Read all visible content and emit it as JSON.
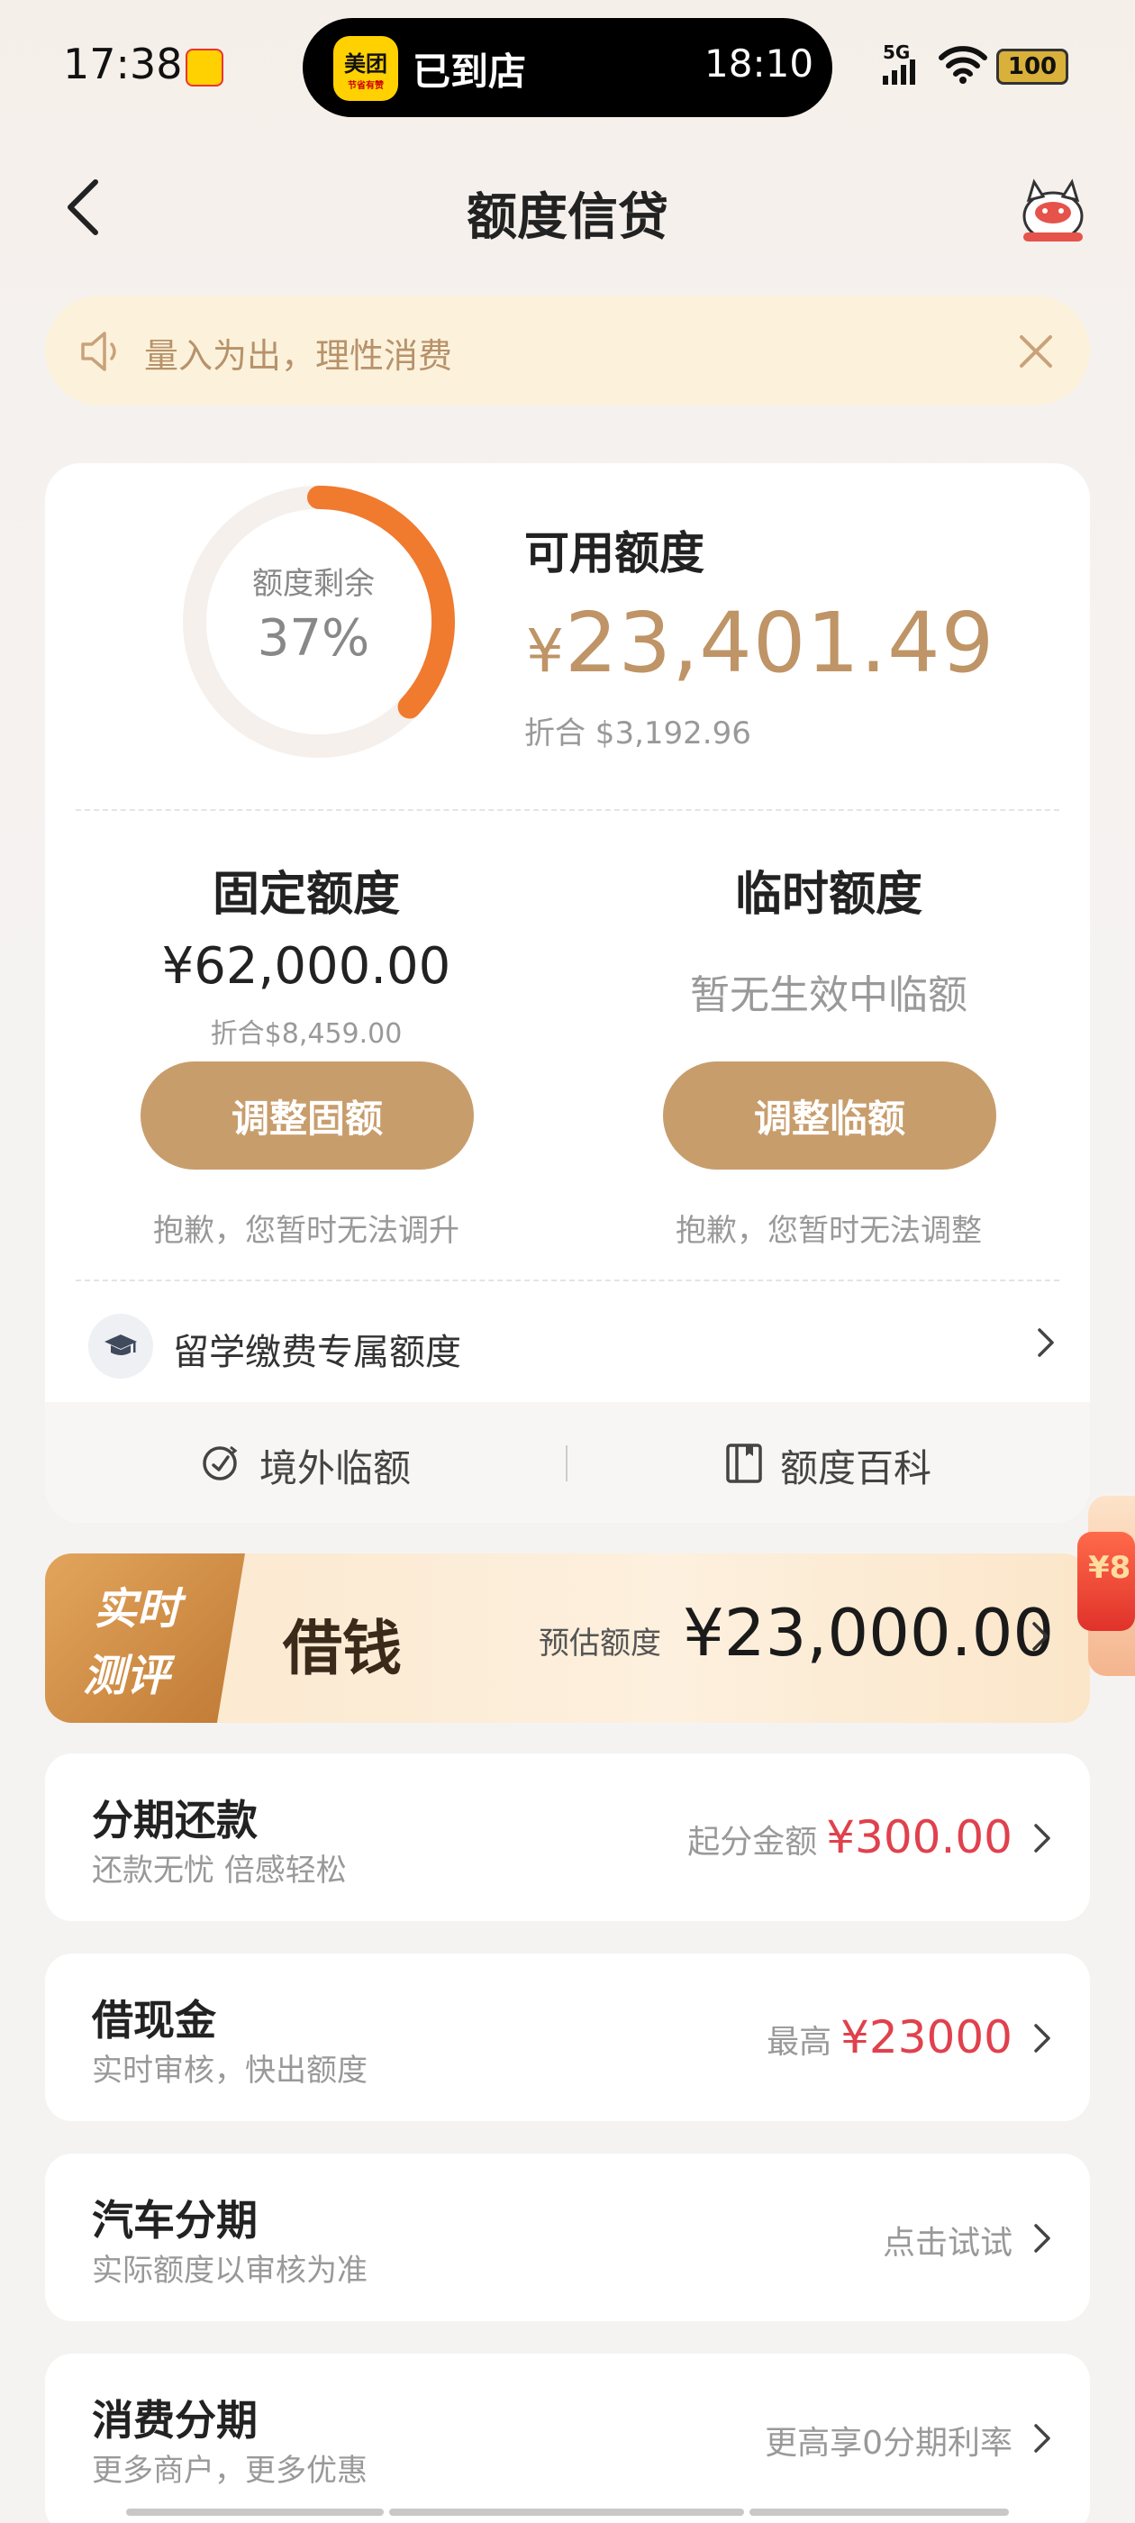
{
  "status_bar": {
    "time": "17:38",
    "island_app": "美团",
    "island_app_sub": "节省有赞",
    "island_status": "已到店",
    "island_time": "18:10",
    "network": "5G",
    "battery": "100"
  },
  "header": {
    "title": "额度信贷",
    "back_icon": "chevron-left-icon",
    "mascot_icon": "mascot-icon"
  },
  "notice": {
    "text": "量入为出，理性消费",
    "icon": "speaker-icon",
    "close_icon": "close-icon"
  },
  "credit": {
    "ring_label": "额度剩余",
    "ring_value": "37%",
    "ring_fraction": 0.37,
    "available_label": "可用额度",
    "available_currency": "¥",
    "available_amount": "23,401.49",
    "available_approx": "折合 $3,192.96",
    "fixed": {
      "title": "固定额度",
      "amount": "¥62,000.00",
      "approx": "折合$8,459.00",
      "button": "调整固额",
      "note": "抱歉，您暂时无法调升"
    },
    "temp": {
      "title": "临时额度",
      "empty": "暂无生效中临额",
      "button": "调整临额",
      "note": "抱歉，您暂时无法调整"
    },
    "study_abroad": "留学缴费专属额度",
    "links": {
      "overseas": "境外临额",
      "wiki": "额度百科"
    }
  },
  "borrow": {
    "badge_line1": "实时",
    "badge_line2": "测评",
    "title": "借钱",
    "est_label": "预估额度",
    "est_value": "¥23,000.00"
  },
  "promo": {
    "amount_hint": "¥8"
  },
  "services": [
    {
      "title": "分期还款",
      "subtitle": "还款无忧 倍感轻松",
      "right_label": "起分金额",
      "right_price": "¥300.00"
    },
    {
      "title": "借现金",
      "subtitle": "实时审核，快出额度",
      "right_label": "最高",
      "right_price": "¥23000"
    },
    {
      "title": "汽车分期",
      "subtitle": "实际额度以审核为准",
      "right_label": "点击试试",
      "right_price": ""
    },
    {
      "title": "消费分期",
      "subtitle": "更多商户，更多优惠",
      "right_label": "更高享0分期利率",
      "right_price": ""
    }
  ],
  "colors": {
    "accent_gold": "#c89d6c",
    "ring_orange": "#f07a2e",
    "price_red": "#e0414d",
    "amount_gold": "#bf9466"
  }
}
